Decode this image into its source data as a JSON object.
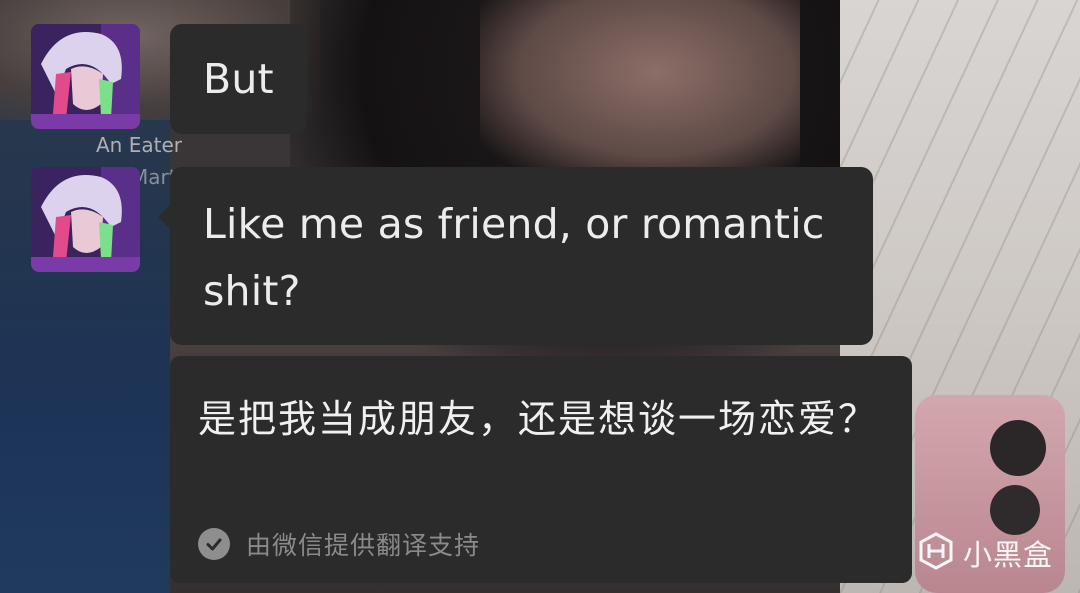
{
  "chat": {
    "contact_name_line1": "An Eater",
    "contact_name_line2": "Mart",
    "messages": [
      {
        "text": "But"
      },
      {
        "text": "Like me as friend, or romantic shit?"
      }
    ],
    "translation": {
      "text": "是把我当成朋友，还是想谈一场恋爱？",
      "credit": "由微信提供翻译支持",
      "icon": "check-circle-icon"
    }
  },
  "watermark": {
    "text": "小黑盒",
    "icon": "xiaoheihe-logo-icon"
  },
  "colors": {
    "bubble": "#2b2b2b",
    "text": "#ececec",
    "credit": "#8a8a8a"
  }
}
